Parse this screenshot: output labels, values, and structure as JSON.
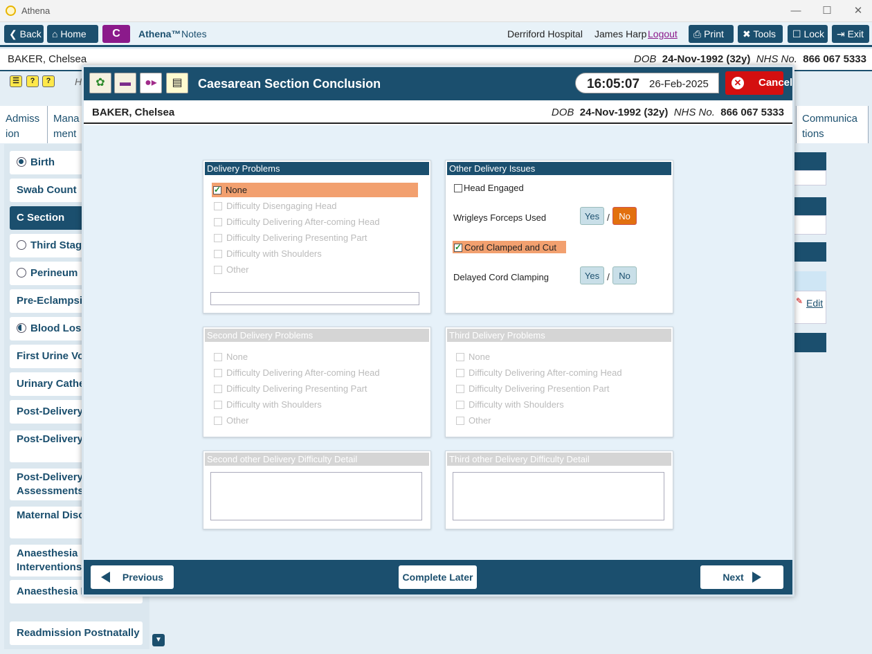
{
  "window": {
    "title": "Athena",
    "minimize": "—",
    "maximize": "☐",
    "close": "✕"
  },
  "toolbar": {
    "back": "Back",
    "home": "Home",
    "c_badge": "C",
    "app_name": "Athena™",
    "app_section": "Notes",
    "hospital": "Derriford Hospital",
    "user": "James Harp",
    "logout": "Logout",
    "print": "Print",
    "tools": "Tools",
    "lock": "Lock",
    "exit": "Exit"
  },
  "patient": {
    "name": "BAKER, Chelsea",
    "dob_label": "DOB",
    "dob": "24-Nov-1992 (32y)",
    "nhs_label": "NHS No.",
    "nhs": "866 067 5333"
  },
  "behind_text": {
    "h": "H",
    "edit": "Edit"
  },
  "tabs": [
    {
      "line1": "Admiss",
      "line2": "ion"
    },
    {
      "line1": "Mana",
      "line2": "ment"
    },
    {
      "line1": "Communica",
      "line2": "tions"
    }
  ],
  "sidebar": [
    {
      "label": "Birth",
      "radio": "on"
    },
    {
      "label": "Swab Count",
      "radio": ""
    },
    {
      "label": "C Section",
      "radio": "",
      "active": true
    },
    {
      "label": "Third Stage",
      "radio": "off"
    },
    {
      "label": "Perineum",
      "radio": "off"
    },
    {
      "label": "Pre-Eclampsia",
      "radio": ""
    },
    {
      "label": "Blood Loss",
      "radio": "half"
    },
    {
      "label": "First Urine Voi",
      "radio": ""
    },
    {
      "label": "Urinary Cathe",
      "radio": ""
    },
    {
      "label": "Post-Delivery",
      "radio": ""
    },
    {
      "label": "Post-Delivery Notes",
      "radio": ""
    },
    {
      "label": "Post-Delivery Assessments",
      "radio": ""
    },
    {
      "label": "Maternal Disc Summary",
      "radio": ""
    },
    {
      "label": "Anaesthesia Interventions",
      "radio": ""
    },
    {
      "label": "Anaesthesia Fo",
      "radio": ""
    },
    {
      "label": "Readmission Postnatally",
      "radio": ""
    }
  ],
  "modal": {
    "title": "Caesarean Section Conclusion",
    "time": "16:05:07",
    "date": "26-Feb-2025",
    "cancel": "Cancel",
    "patient_name": "BAKER, Chelsea",
    "delivery_problems": {
      "header": "Delivery Problems",
      "options": [
        "None",
        "Difficulty Disengaging Head",
        "Difficulty Delivering After-coming Head",
        "Difficulty Delivering Presenting Part",
        "Difficulty with Shoulders",
        "Other"
      ],
      "selected": "None"
    },
    "other_issues": {
      "header": "Other Delivery Issues",
      "head_engaged": "Head Engaged",
      "wrigleys": "Wrigleys Forceps Used",
      "wrigleys_value": "No",
      "cord_clamped": "Cord Clamped and Cut",
      "delayed": "Delayed Cord Clamping",
      "yes": "Yes",
      "no": "No",
      "slash": "/"
    },
    "second_problems": {
      "header": "Second Delivery Problems",
      "options": [
        "None",
        "Difficulty Delivering After-coming Head",
        "Difficulty Delivering Presenting Part",
        "Difficulty with Shoulders",
        "Other"
      ]
    },
    "third_problems": {
      "header": "Third Delivery Problems",
      "options": [
        "None",
        "Difficulty Delivering After-coming Head",
        "Difficulty Delivering Presention Part",
        "Difficulty with Shoulders",
        "Other"
      ]
    },
    "second_detail": {
      "header": "Second other Delivery Difficulty Detail"
    },
    "third_detail": {
      "header": "Third other Delivery Difficulty Detail"
    },
    "footer": {
      "previous": "Previous",
      "complete_later": "Complete Later",
      "next": "Next"
    }
  },
  "colors": {
    "primary": "#1b4f6e",
    "selected": "#f2a06f",
    "cancel": "#d40f0f",
    "no_active": "#e2700f"
  }
}
